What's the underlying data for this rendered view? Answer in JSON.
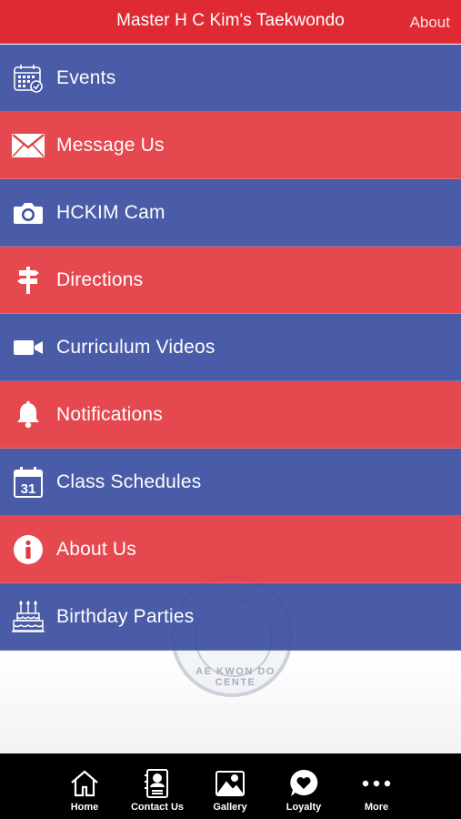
{
  "header": {
    "title": "Master H C Kim's Taekwondo",
    "about_label": "About"
  },
  "menu": {
    "items": [
      {
        "label": "Events",
        "icon": "calendar-icon",
        "color": "blue"
      },
      {
        "label": "Message Us",
        "icon": "envelope-icon",
        "color": "red"
      },
      {
        "label": "HCKIM Cam",
        "icon": "camera-icon",
        "color": "blue"
      },
      {
        "label": "Directions",
        "icon": "signpost-icon",
        "color": "red"
      },
      {
        "label": "Curriculum Videos",
        "icon": "video-camera-icon",
        "color": "blue"
      },
      {
        "label": "Notifications",
        "icon": "bell-icon",
        "color": "red"
      },
      {
        "label": "Class Schedules",
        "icon": "calendar-31-icon",
        "color": "blue"
      },
      {
        "label": "About Us",
        "icon": "info-icon",
        "color": "red"
      },
      {
        "label": "Birthday Parties",
        "icon": "birthday-cake-icon",
        "color": "blue"
      }
    ]
  },
  "emblem": {
    "text": "AE KWON DO CENTE"
  },
  "tabbar": {
    "items": [
      {
        "label": "Home",
        "icon": "home-icon"
      },
      {
        "label": "Contact Us",
        "icon": "contact-card-icon"
      },
      {
        "label": "Gallery",
        "icon": "gallery-icon"
      },
      {
        "label": "Loyalty",
        "icon": "heart-bubble-icon"
      },
      {
        "label": "More",
        "icon": "more-dots-icon"
      }
    ]
  },
  "colors": {
    "header_red": "#e02a33",
    "menu_blue": "#3c4fa0",
    "menu_red": "#e33a42",
    "tabbar_bg": "#000000"
  }
}
